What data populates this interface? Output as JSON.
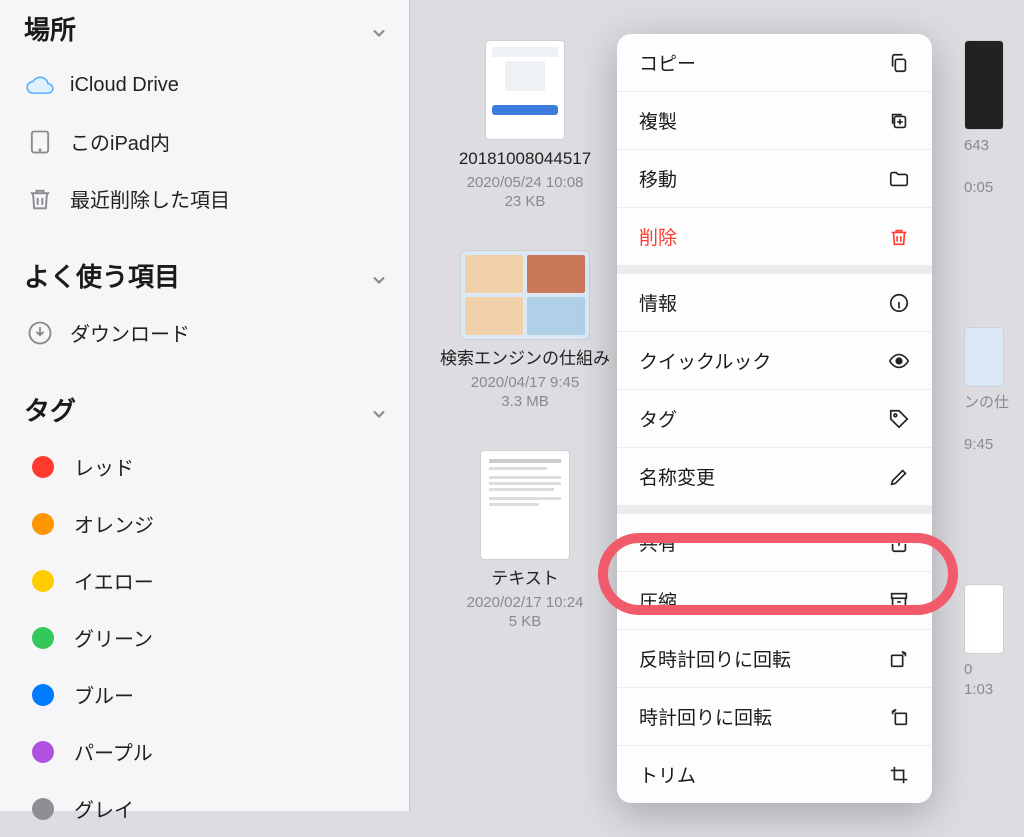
{
  "sidebar": {
    "locations": {
      "header": "場所",
      "items": [
        {
          "label": "iCloud Drive",
          "icon": "cloud"
        },
        {
          "label": "このiPad内",
          "icon": "ipad"
        },
        {
          "label": "最近削除した項目",
          "icon": "trash"
        }
      ]
    },
    "favorites": {
      "header": "よく使う項目",
      "items": [
        {
          "label": "ダウンロード",
          "icon": "download"
        }
      ]
    },
    "tags": {
      "header": "タグ",
      "items": [
        {
          "label": "レッド",
          "color": "#ff3b30"
        },
        {
          "label": "オレンジ",
          "color": "#ff9500"
        },
        {
          "label": "イエロー",
          "color": "#ffcc00"
        },
        {
          "label": "グリーン",
          "color": "#34c759"
        },
        {
          "label": "ブルー",
          "color": "#007aff"
        },
        {
          "label": "パープル",
          "color": "#af52de"
        },
        {
          "label": "グレイ",
          "color": "#8e8e93"
        }
      ]
    }
  },
  "files": {
    "column1": [
      {
        "name": "20181008044517",
        "date": "2020/05/24 10:08",
        "size": "23 KB"
      },
      {
        "name": "検索エンジンの仕組み",
        "date": "2020/04/17 9:45",
        "size": "3.3 MB"
      },
      {
        "name": "テキスト",
        "date": "2020/02/17 10:24",
        "size": "5 KB"
      }
    ],
    "peek": [
      {
        "name": "643",
        "date": "0:05"
      },
      {
        "name": "ンの仕",
        "date": "9:45"
      },
      {
        "name": "0",
        "date": "1:03"
      }
    ]
  },
  "menu": {
    "copy": "コピー",
    "duplicate": "複製",
    "move": "移動",
    "delete": "削除",
    "info": "情報",
    "quicklook": "クイックルック",
    "tags": "タグ",
    "rename": "名称変更",
    "share": "共有",
    "compress": "圧縮",
    "rotate_ccw": "反時計回りに回転",
    "rotate_cw": "時計回りに回転",
    "trim": "トリム"
  },
  "annotation": {
    "highlighted_item": "compress"
  }
}
